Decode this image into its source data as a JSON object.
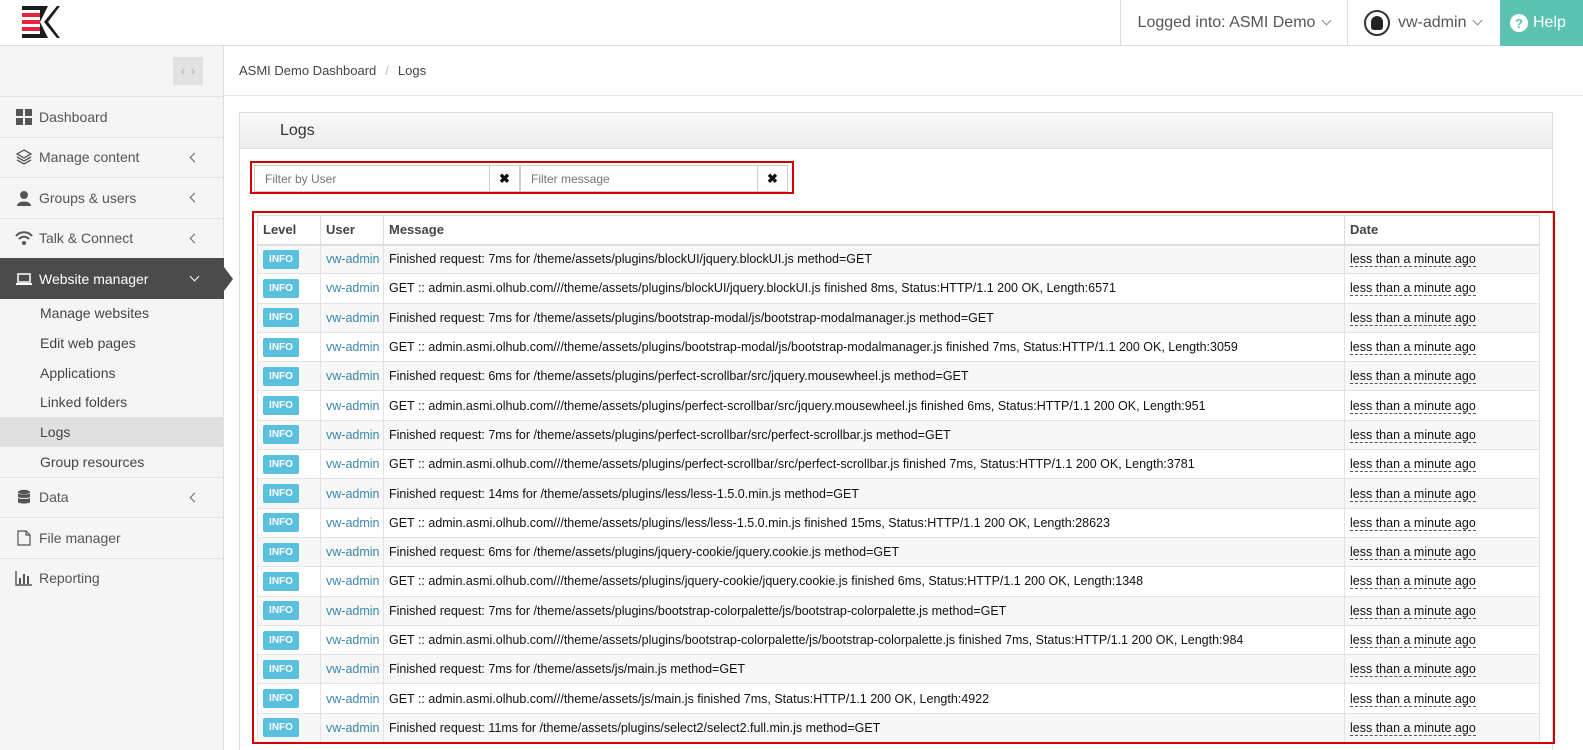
{
  "topbar": {
    "org_label": "Logged into: ASMI Demo",
    "user_label": "vw-admin",
    "help_label": "Help",
    "help_glyph": "?"
  },
  "sidebar": {
    "items": [
      {
        "label": "Dashboard",
        "icon": "grid-icon"
      },
      {
        "label": "Manage content",
        "icon": "layers-icon"
      },
      {
        "label": "Groups & users",
        "icon": "user-icon"
      },
      {
        "label": "Talk & Connect",
        "icon": "wifi-icon"
      },
      {
        "label": "Website manager",
        "icon": "laptop-icon"
      },
      {
        "label": "Data",
        "icon": "database-icon"
      },
      {
        "label": "File manager",
        "icon": "file-icon"
      },
      {
        "label": "Reporting",
        "icon": "bar-chart-icon"
      }
    ],
    "sub_items": [
      "Manage websites",
      "Edit web pages",
      "Applications",
      "Linked folders",
      "Logs",
      "Group resources"
    ]
  },
  "breadcrumb": {
    "root": "ASMI Demo Dashboard",
    "separator": "/",
    "current": "Logs"
  },
  "panel": {
    "title": "Logs"
  },
  "filters": {
    "user_placeholder": "Filter by User",
    "message_placeholder": "Filter message",
    "clear_glyph": "✖"
  },
  "table": {
    "columns": {
      "level": "Level",
      "user": "User",
      "message": "Message",
      "date": "Date"
    },
    "rows": [
      {
        "level": "INFO",
        "user": "vw-admin",
        "message": "Finished request: 7ms for /theme/assets/plugins/blockUI/jquery.blockUI.js method=GET",
        "date": "less than a minute ago"
      },
      {
        "level": "INFO",
        "user": "vw-admin",
        "message": "GET :: admin.asmi.olhub.com///theme/assets/plugins/blockUI/jquery.blockUI.js finished 8ms, Status:HTTP/1.1 200 OK, Length:6571",
        "date": "less than a minute ago"
      },
      {
        "level": "INFO",
        "user": "vw-admin",
        "message": "Finished request: 7ms for /theme/assets/plugins/bootstrap-modal/js/bootstrap-modalmanager.js method=GET",
        "date": "less than a minute ago"
      },
      {
        "level": "INFO",
        "user": "vw-admin",
        "message": "GET :: admin.asmi.olhub.com///theme/assets/plugins/bootstrap-modal/js/bootstrap-modalmanager.js finished 7ms, Status:HTTP/1.1 200 OK, Length:3059",
        "date": "less than a minute ago"
      },
      {
        "level": "INFO",
        "user": "vw-admin",
        "message": "Finished request: 6ms for /theme/assets/plugins/perfect-scrollbar/src/jquery.mousewheel.js method=GET",
        "date": "less than a minute ago"
      },
      {
        "level": "INFO",
        "user": "vw-admin",
        "message": "GET :: admin.asmi.olhub.com///theme/assets/plugins/perfect-scrollbar/src/jquery.mousewheel.js finished 6ms, Status:HTTP/1.1 200 OK, Length:951",
        "date": "less than a minute ago"
      },
      {
        "level": "INFO",
        "user": "vw-admin",
        "message": "Finished request: 7ms for /theme/assets/plugins/perfect-scrollbar/src/perfect-scrollbar.js method=GET",
        "date": "less than a minute ago"
      },
      {
        "level": "INFO",
        "user": "vw-admin",
        "message": "GET :: admin.asmi.olhub.com///theme/assets/plugins/perfect-scrollbar/src/perfect-scrollbar.js finished 7ms, Status:HTTP/1.1 200 OK, Length:3781",
        "date": "less than a minute ago"
      },
      {
        "level": "INFO",
        "user": "vw-admin",
        "message": "Finished request: 14ms for /theme/assets/plugins/less/less-1.5.0.min.js method=GET",
        "date": "less than a minute ago"
      },
      {
        "level": "INFO",
        "user": "vw-admin",
        "message": "GET :: admin.asmi.olhub.com///theme/assets/plugins/less/less-1.5.0.min.js finished 15ms, Status:HTTP/1.1 200 OK, Length:28623",
        "date": "less than a minute ago"
      },
      {
        "level": "INFO",
        "user": "vw-admin",
        "message": "Finished request: 6ms for /theme/assets/plugins/jquery-cookie/jquery.cookie.js method=GET",
        "date": "less than a minute ago"
      },
      {
        "level": "INFO",
        "user": "vw-admin",
        "message": "GET :: admin.asmi.olhub.com///theme/assets/plugins/jquery-cookie/jquery.cookie.js finished 6ms, Status:HTTP/1.1 200 OK, Length:1348",
        "date": "less than a minute ago"
      },
      {
        "level": "INFO",
        "user": "vw-admin",
        "message": "Finished request: 7ms for /theme/assets/plugins/bootstrap-colorpalette/js/bootstrap-colorpalette.js method=GET",
        "date": "less than a minute ago"
      },
      {
        "level": "INFO",
        "user": "vw-admin",
        "message": "GET :: admin.asmi.olhub.com///theme/assets/plugins/bootstrap-colorpalette/js/bootstrap-colorpalette.js finished 7ms, Status:HTTP/1.1 200 OK, Length:984",
        "date": "less than a minute ago"
      },
      {
        "level": "INFO",
        "user": "vw-admin",
        "message": "Finished request: 7ms for /theme/assets/js/main.js method=GET",
        "date": "less than a minute ago"
      },
      {
        "level": "INFO",
        "user": "vw-admin",
        "message": "GET :: admin.asmi.olhub.com///theme/assets/js/main.js finished 7ms, Status:HTTP/1.1 200 OK, Length:4922",
        "date": "less than a minute ago"
      },
      {
        "level": "INFO",
        "user": "vw-admin",
        "message": "Finished request: 11ms for /theme/assets/plugins/select2/select2.full.min.js method=GET",
        "date": "less than a minute ago"
      }
    ]
  },
  "colors": {
    "accent_help": "#5cc3b3",
    "badge_info": "#5bc0de",
    "active_nav": "#4b4b4b",
    "highlight_border": "#d40000",
    "logo_red": "#e8213c",
    "logo_dark": "#1c1c1c"
  }
}
